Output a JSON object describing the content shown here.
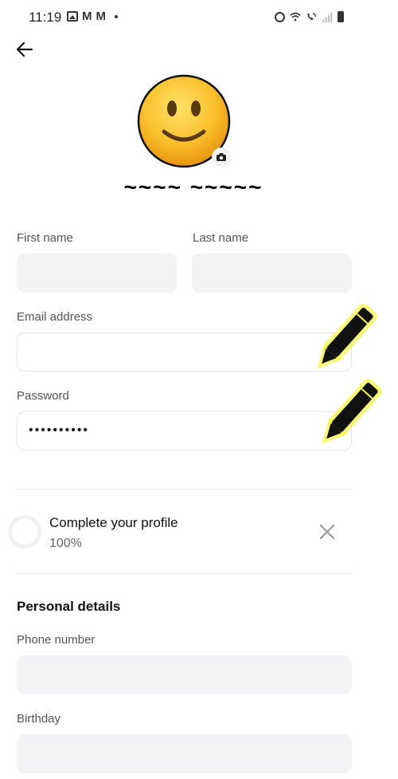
{
  "status_bar": {
    "time": "11:19",
    "left_icons": [
      "gallery-icon",
      "gmail-icon",
      "gmail-icon",
      "notification-dot-icon"
    ],
    "right_icons": [
      "alarm-icon",
      "wifi-icon",
      "wifi-calling-icon",
      "signal-icon",
      "battery-icon"
    ]
  },
  "header": {
    "back_icon": "arrow-left-icon"
  },
  "profile": {
    "avatar_icon": "slightly-smiling-face-emoji",
    "camera_icon": "camera-icon",
    "name": "~~~~ ~~~~~"
  },
  "form": {
    "first_name": {
      "label": "First name",
      "value": ""
    },
    "last_name": {
      "label": "Last name",
      "value": ""
    },
    "email": {
      "label": "Email address",
      "value": ""
    },
    "password": {
      "label": "Password",
      "value": "••••••••••"
    },
    "edit_icon": "pencil-icon"
  },
  "completion": {
    "title": "Complete your profile",
    "percent_text": "100%",
    "progress": 1.0,
    "close_icon": "close-icon"
  },
  "personal_details": {
    "title": "Personal details",
    "phone": {
      "label": "Phone number",
      "value": ""
    },
    "birthday": {
      "label": "Birthday",
      "value": ""
    }
  },
  "colors": {
    "input_fill": "#f1f3f5",
    "input_border": "#e3e5e8",
    "highlight_glow": "#f5f542",
    "divider": "#e6e6e6"
  }
}
